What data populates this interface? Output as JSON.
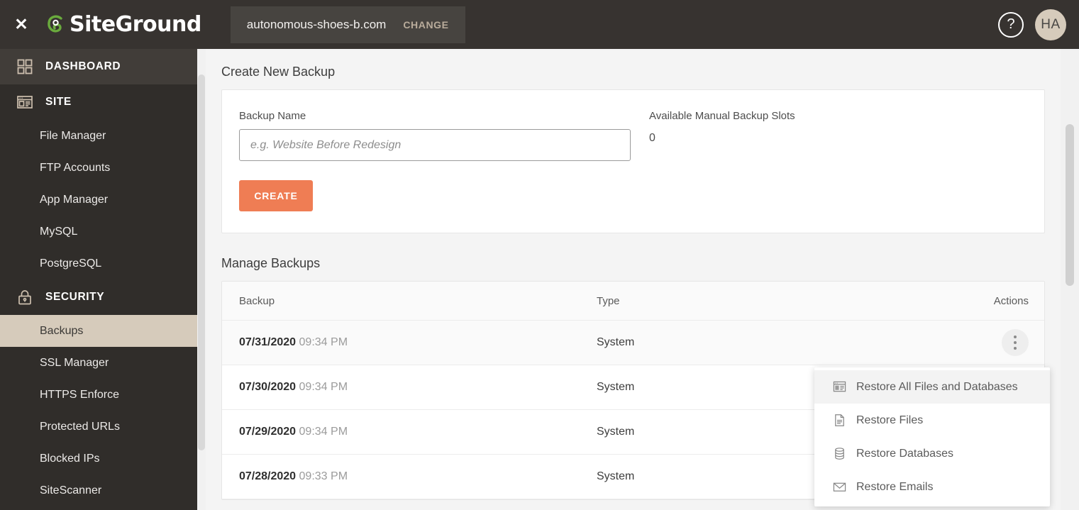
{
  "topbar": {
    "close_label": "✕",
    "brand_name": "SiteGround",
    "domain": "autonomous-shoes-b.com",
    "change_label": "CHANGE",
    "help_label": "?",
    "avatar_initials": "HA"
  },
  "sidebar": {
    "sections": [
      {
        "label": "DASHBOARD",
        "icon": "grid-icon",
        "active": true,
        "items": []
      },
      {
        "label": "SITE",
        "icon": "window-icon",
        "active": false,
        "items": [
          "File Manager",
          "FTP Accounts",
          "App Manager",
          "MySQL",
          "PostgreSQL"
        ]
      },
      {
        "label": "SECURITY",
        "icon": "lock-icon",
        "active": false,
        "items": [
          "Backups",
          "SSL Manager",
          "HTTPS Enforce",
          "Protected URLs",
          "Blocked IPs",
          "SiteScanner"
        ]
      }
    ],
    "active_item": "Backups"
  },
  "create_backup": {
    "title": "Create New Backup",
    "name_label": "Backup Name",
    "name_value": "",
    "name_placeholder": "e.g. Website Before Redesign",
    "create_button": "CREATE",
    "slots_label": "Available Manual Backup Slots",
    "slots_value": "0"
  },
  "manage_backups": {
    "title": "Manage Backups",
    "columns": [
      "Backup",
      "Type",
      "Actions"
    ],
    "rows": [
      {
        "date": "07/31/2020",
        "time": "09:34 PM",
        "type": "System"
      },
      {
        "date": "07/30/2020",
        "time": "09:34 PM",
        "type": "System"
      },
      {
        "date": "07/29/2020",
        "time": "09:34 PM",
        "type": "System"
      },
      {
        "date": "07/28/2020",
        "time": "09:33 PM",
        "type": "System"
      }
    ]
  },
  "actions_menu": {
    "items": [
      {
        "label": "Restore All Files and Databases",
        "icon": "window-icon",
        "highlighted": true
      },
      {
        "label": "Restore Files",
        "icon": "document-icon",
        "highlighted": false
      },
      {
        "label": "Restore Databases",
        "icon": "database-icon",
        "highlighted": false
      },
      {
        "label": "Restore Emails",
        "icon": "envelope-icon",
        "highlighted": false
      }
    ]
  },
  "colors": {
    "header_bg": "#373330",
    "sidebar_bg": "#302d2a",
    "accent_orange": "#ef7d54",
    "active_beige": "#d6cbbb",
    "brand_green": "#6aab3d"
  }
}
